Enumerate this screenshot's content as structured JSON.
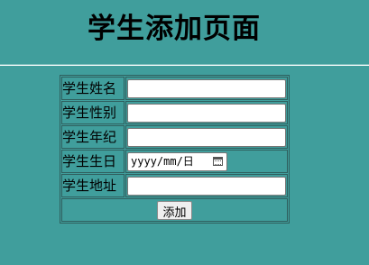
{
  "page": {
    "title": "学生添加页面"
  },
  "form": {
    "fields": [
      {
        "label": "学生姓名",
        "value": ""
      },
      {
        "label": "学生性别",
        "value": ""
      },
      {
        "label": "学生年纪",
        "value": ""
      },
      {
        "label": "学生生日",
        "placeholder": "yyyy/mm/日"
      },
      {
        "label": "学生地址",
        "value": ""
      }
    ],
    "submit_label": "添加"
  },
  "colors": {
    "background": "#409e9c",
    "border": "#2f5f5e"
  },
  "icons": {
    "date_picker": "calendar-icon"
  }
}
